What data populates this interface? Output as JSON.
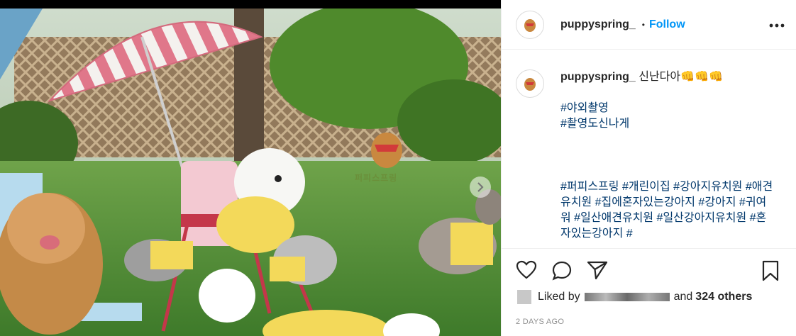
{
  "post": {
    "username": "puppyspring_",
    "dot": "•",
    "follow_label": "Follow",
    "watermark": "퍼피스프링",
    "caption": {
      "username": "puppyspring_",
      "text": "신난다아👊👊👊",
      "tags_line1": "#야외촬영",
      "tags_line2": "#촬영도신나게",
      "tags_block": "#퍼피스프링 #개린이집 #강아지유치원 #애견유치원 #집에혼자있는강아지 #강아지 #귀여워 #일산애견유치원 #일산강아지유치원 #혼자있는강아지 #"
    },
    "likes": {
      "prefix": "Liked by",
      "and": "and",
      "others": "324 others"
    },
    "timestamp": "2 DAYS AGO"
  },
  "icons": {
    "more": "more-icon",
    "heart": "heart-icon",
    "comment": "comment-icon",
    "share": "share-icon",
    "bookmark": "bookmark-icon",
    "next": "chevron-right-icon"
  }
}
